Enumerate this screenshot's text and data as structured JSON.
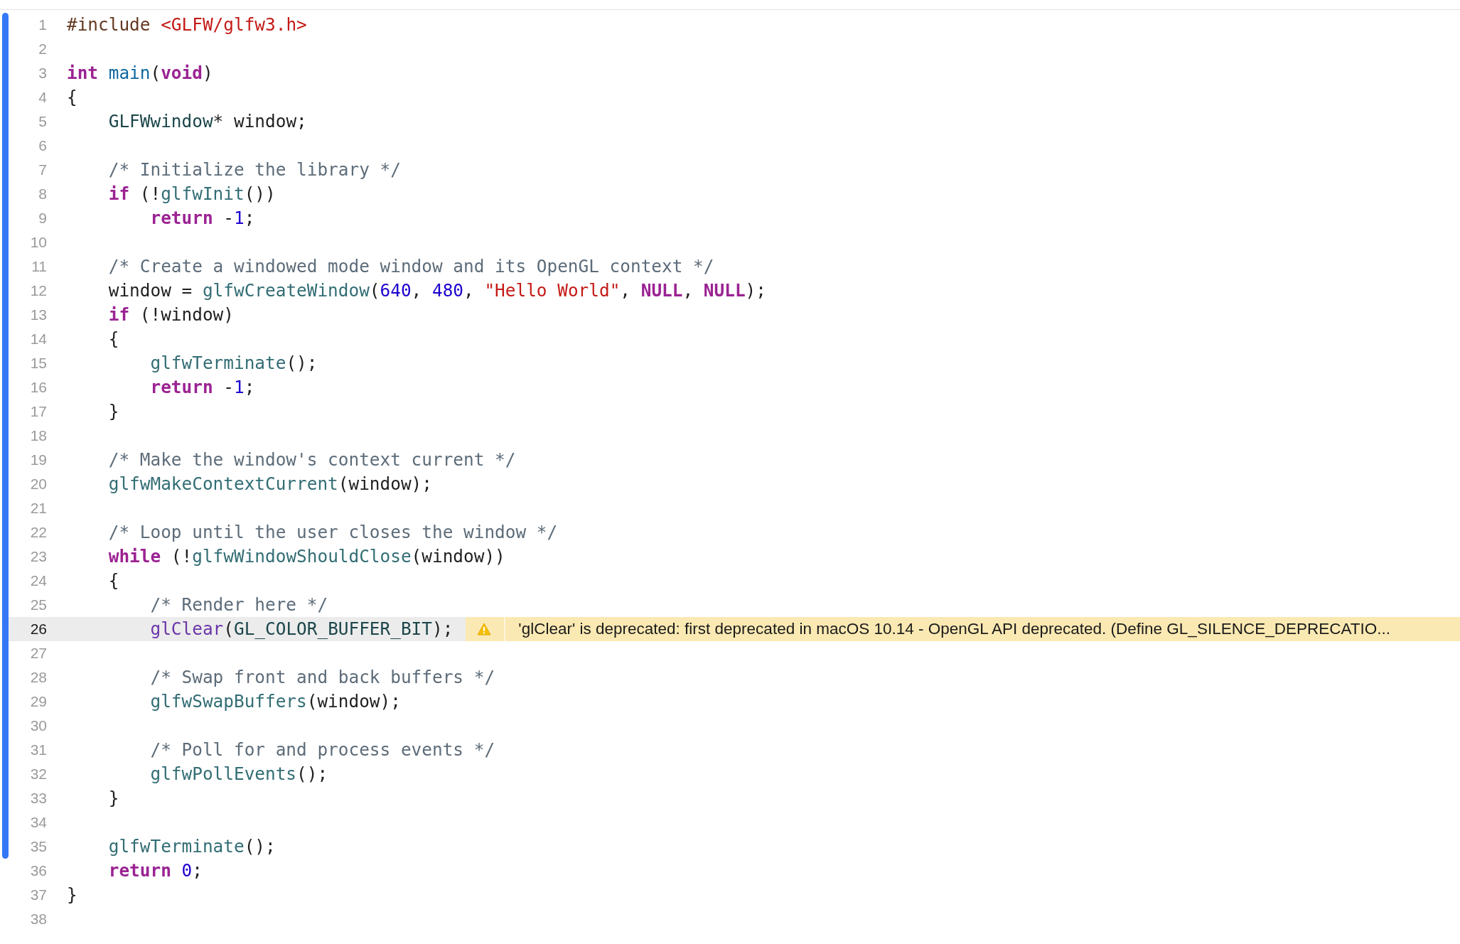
{
  "lines": [
    {
      "number": "1",
      "changed": true,
      "highlighted": false,
      "tokens": [
        {
          "kind": "preproc",
          "text": "#include "
        },
        {
          "kind": "string",
          "text": "<GLFW/glfw3.h>"
        }
      ]
    },
    {
      "number": "2",
      "changed": true,
      "highlighted": false
    },
    {
      "number": "3",
      "changed": true,
      "highlighted": false,
      "tokens": [
        {
          "kind": "keyword",
          "text": "int"
        },
        {
          "kind": "declaration",
          "text": " main"
        },
        {
          "kind": "plain",
          "text": "("
        },
        {
          "kind": "keyword",
          "text": "void"
        },
        {
          "kind": "plain",
          "text": ")"
        }
      ]
    },
    {
      "number": "4",
      "changed": true,
      "highlighted": false,
      "tokens": [
        {
          "kind": "plain",
          "text": "{"
        }
      ]
    },
    {
      "number": "5",
      "changed": true,
      "highlighted": false,
      "tokens": [
        {
          "kind": "type",
          "text": "    GLFWwindow"
        },
        {
          "kind": "plain",
          "text": "* window;"
        }
      ]
    },
    {
      "number": "6",
      "changed": true,
      "highlighted": false
    },
    {
      "number": "7",
      "changed": true,
      "highlighted": false,
      "tokens": [
        {
          "kind": "comment",
          "text": "    /* Initialize the library */"
        }
      ]
    },
    {
      "number": "8",
      "changed": true,
      "highlighted": false,
      "tokens": [
        {
          "kind": "keyword",
          "text": "    if"
        },
        {
          "kind": "plain",
          "text": " (!"
        },
        {
          "kind": "function",
          "text": "glfwInit"
        },
        {
          "kind": "plain",
          "text": "())"
        }
      ]
    },
    {
      "number": "9",
      "changed": true,
      "highlighted": false,
      "tokens": [
        {
          "kind": "keyword",
          "text": "        return"
        },
        {
          "kind": "plain",
          "text": " -"
        },
        {
          "kind": "number",
          "text": "1"
        },
        {
          "kind": "plain",
          "text": ";"
        }
      ]
    },
    {
      "number": "10",
      "changed": true,
      "highlighted": false
    },
    {
      "number": "11",
      "changed": true,
      "highlighted": false,
      "tokens": [
        {
          "kind": "comment",
          "text": "    /* Create a windowed mode window and its OpenGL context */"
        }
      ]
    },
    {
      "number": "12",
      "changed": true,
      "highlighted": false,
      "tokens": [
        {
          "kind": "plain",
          "text": "    window = "
        },
        {
          "kind": "function",
          "text": "glfwCreateWindow"
        },
        {
          "kind": "plain",
          "text": "("
        },
        {
          "kind": "number",
          "text": "640"
        },
        {
          "kind": "plain",
          "text": ", "
        },
        {
          "kind": "number",
          "text": "480"
        },
        {
          "kind": "plain",
          "text": ", "
        },
        {
          "kind": "string",
          "text": "\"Hello World\""
        },
        {
          "kind": "plain",
          "text": ", "
        },
        {
          "kind": "keyword",
          "text": "NULL"
        },
        {
          "kind": "plain",
          "text": ", "
        },
        {
          "kind": "keyword",
          "text": "NULL"
        },
        {
          "kind": "plain",
          "text": ");"
        }
      ]
    },
    {
      "number": "13",
      "changed": true,
      "highlighted": false,
      "tokens": [
        {
          "kind": "keyword",
          "text": "    if"
        },
        {
          "kind": "plain",
          "text": " (!window)"
        }
      ]
    },
    {
      "number": "14",
      "changed": true,
      "highlighted": false,
      "tokens": [
        {
          "kind": "plain",
          "text": "    {"
        }
      ]
    },
    {
      "number": "15",
      "changed": true,
      "highlighted": false,
      "tokens": [
        {
          "kind": "function",
          "text": "        glfwTerminate"
        },
        {
          "kind": "plain",
          "text": "();"
        }
      ]
    },
    {
      "number": "16",
      "changed": true,
      "highlighted": false,
      "tokens": [
        {
          "kind": "keyword",
          "text": "        return"
        },
        {
          "kind": "plain",
          "text": " -"
        },
        {
          "kind": "number",
          "text": "1"
        },
        {
          "kind": "plain",
          "text": ";"
        }
      ]
    },
    {
      "number": "17",
      "changed": true,
      "highlighted": false,
      "tokens": [
        {
          "kind": "plain",
          "text": "    }"
        }
      ]
    },
    {
      "number": "18",
      "changed": true,
      "highlighted": false
    },
    {
      "number": "19",
      "changed": true,
      "highlighted": false,
      "tokens": [
        {
          "kind": "comment",
          "text": "    /* Make the window's context current */"
        }
      ]
    },
    {
      "number": "20",
      "changed": true,
      "highlighted": false,
      "tokens": [
        {
          "kind": "function",
          "text": "    glfwMakeContextCurrent"
        },
        {
          "kind": "plain",
          "text": "(window);"
        }
      ]
    },
    {
      "number": "21",
      "changed": true,
      "highlighted": false
    },
    {
      "number": "22",
      "changed": true,
      "highlighted": false,
      "tokens": [
        {
          "kind": "comment",
          "text": "    /* Loop until the user closes the window */"
        }
      ]
    },
    {
      "number": "23",
      "changed": true,
      "highlighted": false,
      "tokens": [
        {
          "kind": "keyword",
          "text": "    while"
        },
        {
          "kind": "plain",
          "text": " (!"
        },
        {
          "kind": "function",
          "text": "glfwWindowShouldClose"
        },
        {
          "kind": "plain",
          "text": "(window))"
        }
      ]
    },
    {
      "number": "24",
      "changed": true,
      "highlighted": false,
      "tokens": [
        {
          "kind": "plain",
          "text": "    {"
        }
      ]
    },
    {
      "number": "25",
      "changed": true,
      "highlighted": false,
      "tokens": [
        {
          "kind": "comment",
          "text": "        /* Render here */"
        }
      ]
    },
    {
      "number": "26",
      "changed": true,
      "highlighted": true,
      "tokens": [
        {
          "kind": "deprecated",
          "text": "        glClear"
        },
        {
          "kind": "plain",
          "text": "("
        },
        {
          "kind": "type",
          "text": "GL_COLOR_BUFFER_BIT"
        },
        {
          "kind": "plain",
          "text": ");"
        }
      ],
      "warning": {
        "text": "'glClear' is deprecated: first deprecated in macOS 10.14 - OpenGL API deprecated. (Define GL_SILENCE_DEPRECATIO..."
      }
    },
    {
      "number": "27",
      "changed": true,
      "highlighted": false
    },
    {
      "number": "28",
      "changed": true,
      "highlighted": false,
      "tokens": [
        {
          "kind": "comment",
          "text": "        /* Swap front and back buffers */"
        }
      ]
    },
    {
      "number": "29",
      "changed": true,
      "highlighted": false,
      "tokens": [
        {
          "kind": "function",
          "text": "        glfwSwapBuffers"
        },
        {
          "kind": "plain",
          "text": "(window);"
        }
      ]
    },
    {
      "number": "30",
      "changed": true,
      "highlighted": false
    },
    {
      "number": "31",
      "changed": true,
      "highlighted": false,
      "tokens": [
        {
          "kind": "comment",
          "text": "        /* Poll for and process events */"
        }
      ]
    },
    {
      "number": "32",
      "changed": true,
      "highlighted": false,
      "tokens": [
        {
          "kind": "function",
          "text": "        glfwPollEvents"
        },
        {
          "kind": "plain",
          "text": "();"
        }
      ]
    },
    {
      "number": "33",
      "changed": true,
      "highlighted": false,
      "tokens": [
        {
          "kind": "plain",
          "text": "    }"
        }
      ]
    },
    {
      "number": "34",
      "changed": true,
      "highlighted": false
    },
    {
      "number": "35",
      "changed": true,
      "highlighted": false,
      "tokens": [
        {
          "kind": "function",
          "text": "    glfwTerminate"
        },
        {
          "kind": "plain",
          "text": "();"
        }
      ]
    },
    {
      "number": "36",
      "changed": false,
      "highlighted": false,
      "tokens": [
        {
          "kind": "keyword",
          "text": "    return"
        },
        {
          "kind": "number",
          "text": " 0"
        },
        {
          "kind": "plain",
          "text": ";"
        }
      ]
    },
    {
      "number": "37",
      "changed": false,
      "highlighted": false,
      "tokens": [
        {
          "kind": "plain",
          "text": "}"
        }
      ]
    },
    {
      "number": "38",
      "changed": false,
      "highlighted": false
    }
  ]
}
